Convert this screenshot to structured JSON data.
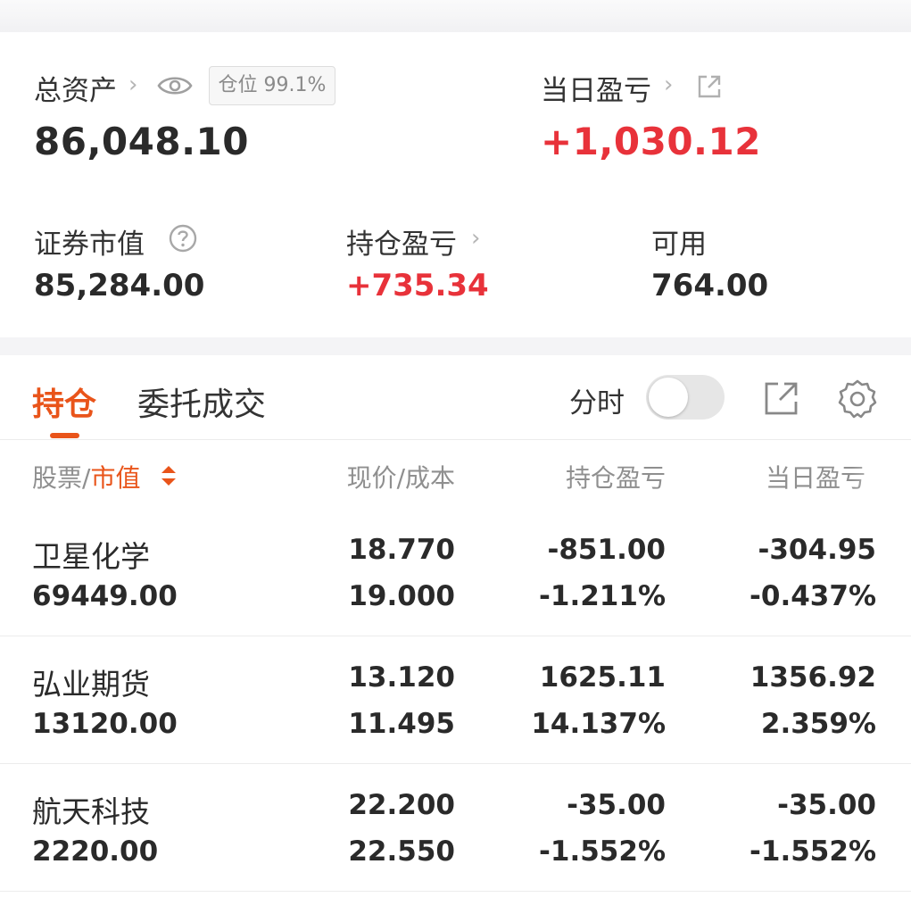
{
  "summary": {
    "total_assets_label": "总资产",
    "total_assets_value": "86,048.10",
    "position_badge": "仓位 99.1%",
    "daily_pnl_label": "当日盈亏",
    "daily_pnl_value": "+1,030.12",
    "securities_value_label": "证券市值",
    "securities_value": "85,284.00",
    "holding_pnl_label": "持仓盈亏",
    "holding_pnl_value": "+735.34",
    "available_label": "可用",
    "available_value": "764.00"
  },
  "tabs": {
    "holdings": "持仓",
    "orders": "委托成交",
    "timeshare_label": "分时",
    "timeshare_on": false
  },
  "table": {
    "headers": {
      "stock": "股票",
      "slash": "/",
      "market_value": "市值",
      "price_cost": "现价/成本",
      "holding_pnl": "持仓盈亏",
      "daily_pnl": "当日盈亏"
    },
    "rows": [
      {
        "name": "卫星化学",
        "market_value": "69449.00",
        "price": "18.770",
        "cost": "19.000",
        "holding_pnl": "-851.00",
        "holding_pct": "-1.211%",
        "daily_pnl": "-304.95",
        "daily_pct": "-0.437%",
        "holding_color": "green",
        "daily_color": "green"
      },
      {
        "name": "弘业期货",
        "market_value": "13120.00",
        "price": "13.120",
        "cost": "11.495",
        "holding_pnl": "1625.11",
        "holding_pct": "14.137%",
        "daily_pnl": "1356.92",
        "daily_pct": "2.359%",
        "holding_color": "red",
        "daily_color": "red"
      },
      {
        "name": "航天科技",
        "market_value": "2220.00",
        "price": "22.200",
        "cost": "22.550",
        "holding_pnl": "-35.00",
        "holding_pct": "-1.552%",
        "daily_pnl": "-35.00",
        "daily_pct": "-1.552%",
        "holding_color": "green",
        "daily_color": "green"
      }
    ]
  },
  "colors": {
    "accent": "#e9541a",
    "gain": "#e8323a",
    "loss": "#1f9a2e"
  },
  "icons": [
    "chevron-right-icon",
    "eye-icon",
    "external-link-icon",
    "help-circle-icon",
    "share-icon",
    "gear-icon",
    "sort-icon"
  ]
}
